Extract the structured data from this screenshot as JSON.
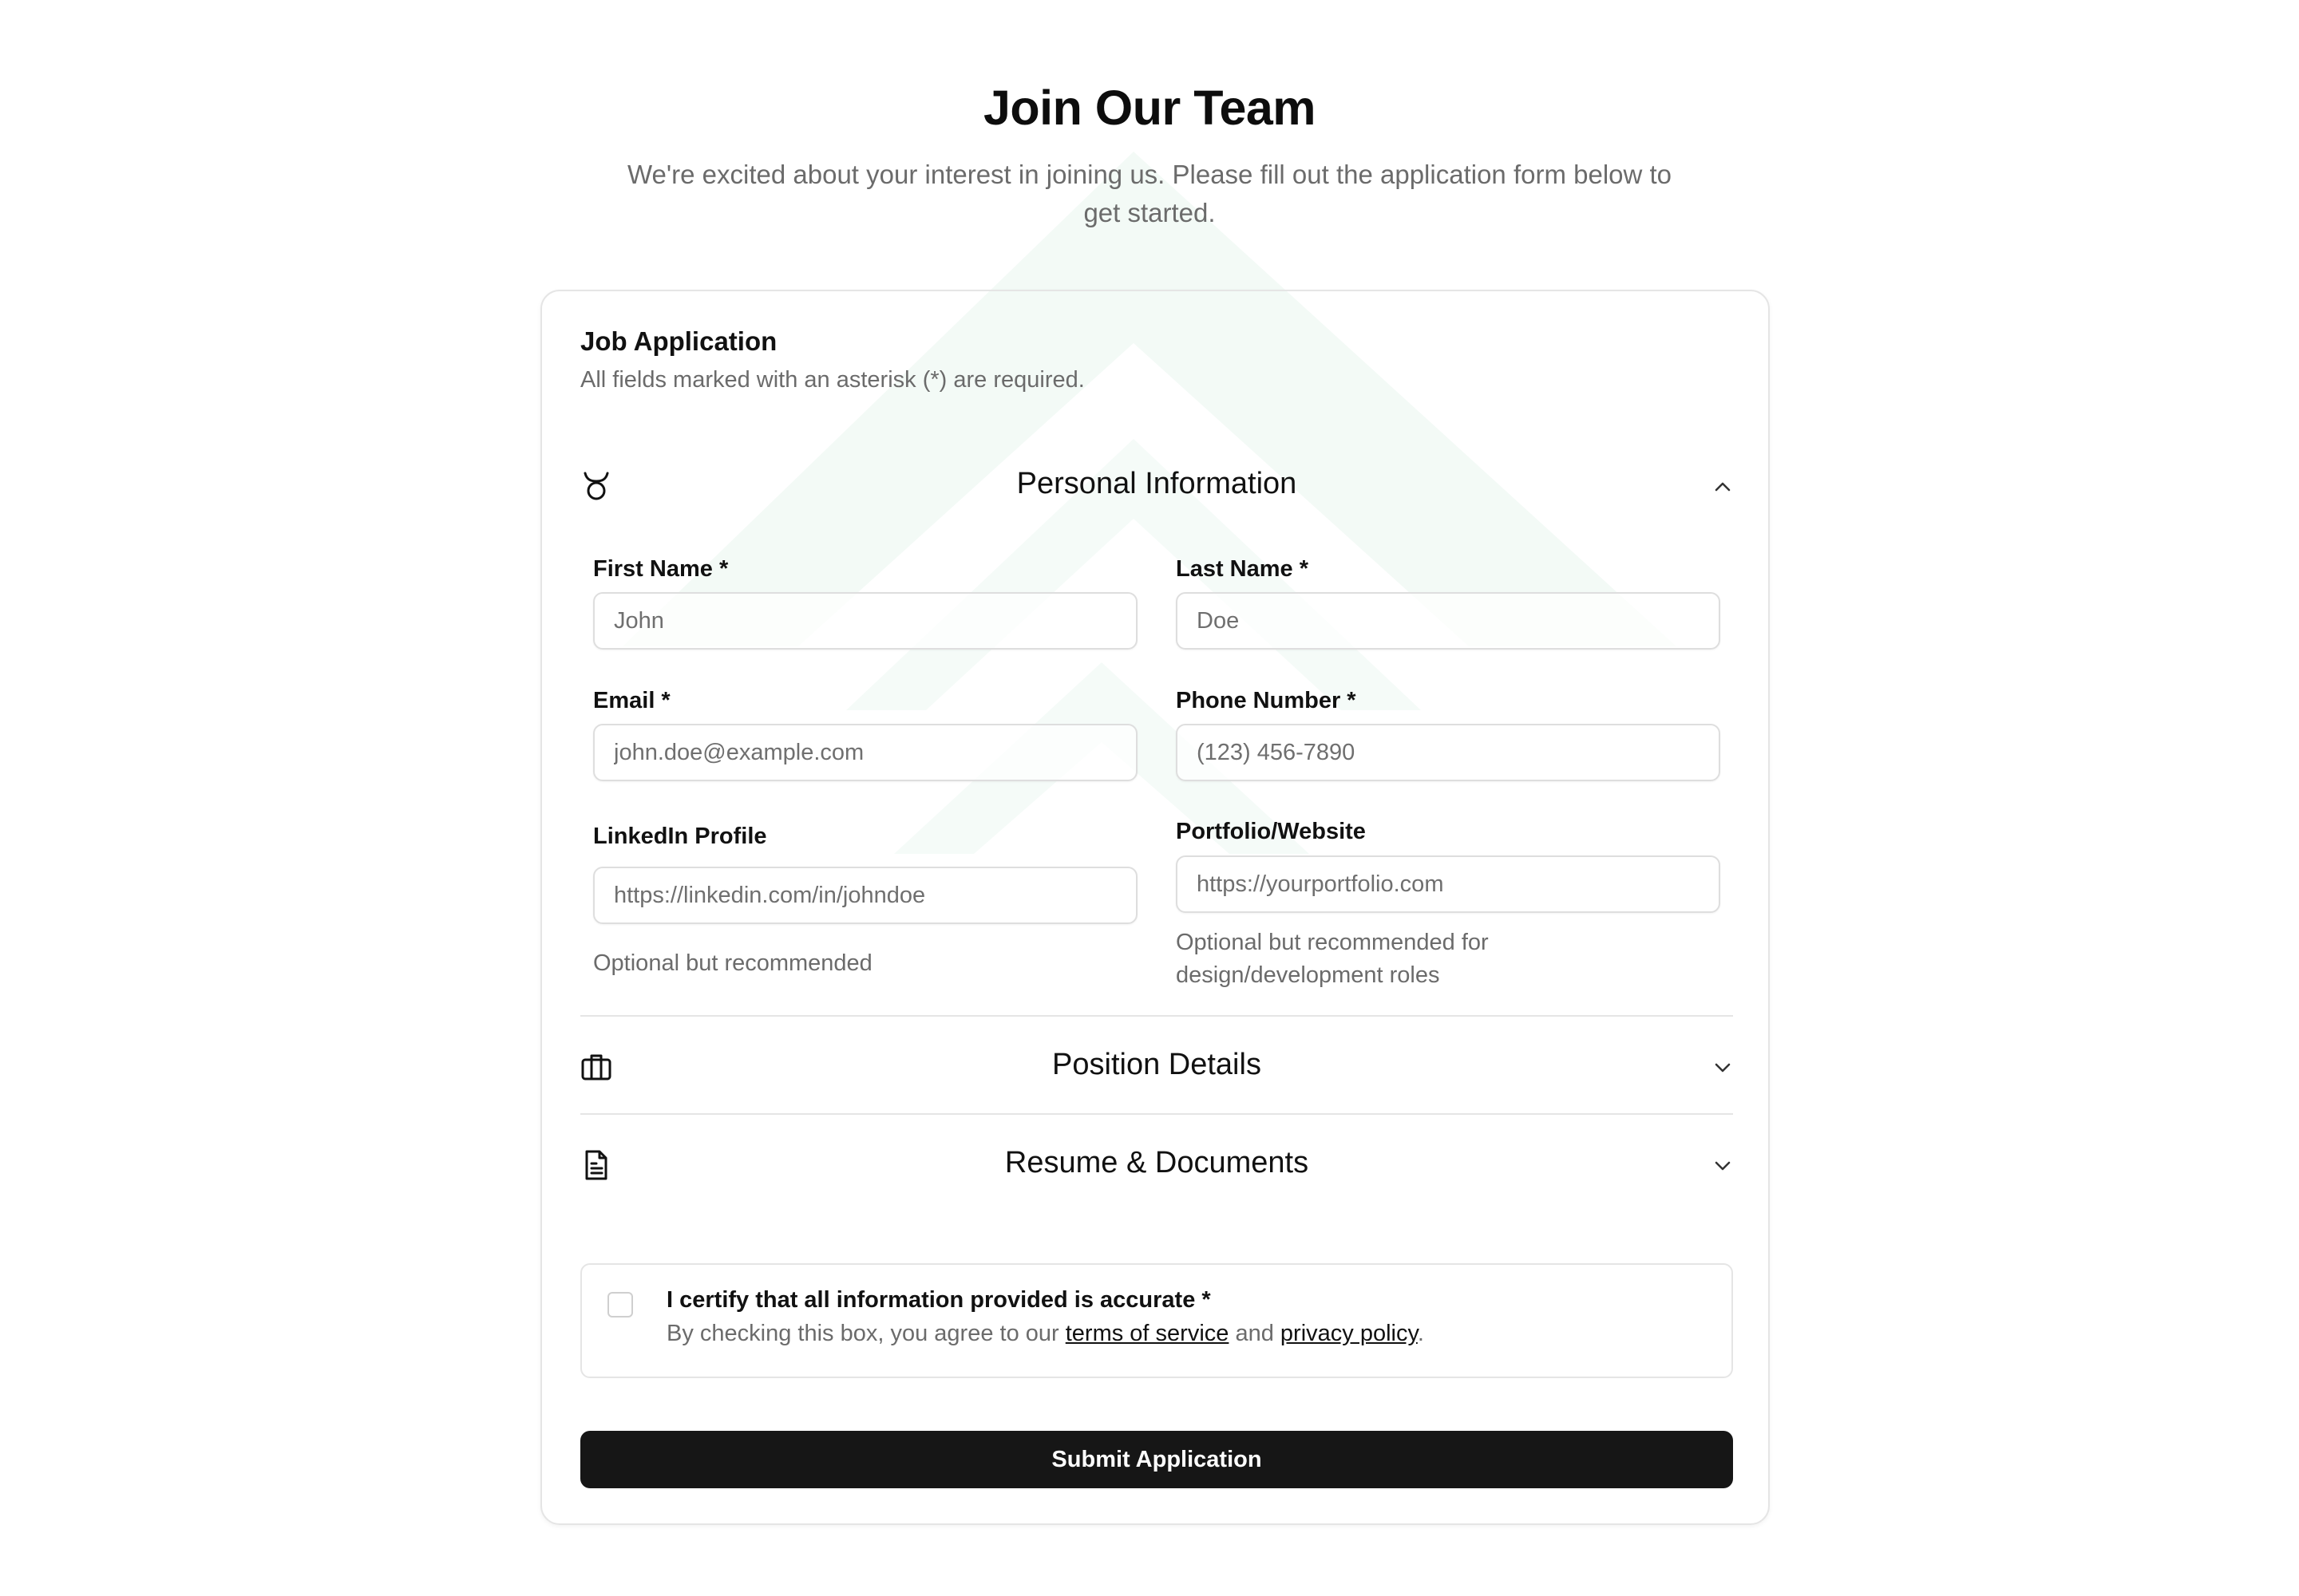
{
  "hero": {
    "title": "Join Our Team",
    "subtitle": "We're excited about your interest in joining us. Please fill out the application form below to get started."
  },
  "form": {
    "title": "Job Application",
    "subtitle": "All fields marked with an asterisk (*) are required."
  },
  "sections": {
    "personal": {
      "title": "Personal Information",
      "icon": "taurus-icon",
      "expanded": true
    },
    "position": {
      "title": "Position Details",
      "icon": "briefcase-icon",
      "expanded": false
    },
    "resume": {
      "title": "Resume & Documents",
      "icon": "document-icon",
      "expanded": false
    }
  },
  "fields": {
    "first_name": {
      "label": "First Name *",
      "placeholder": "John",
      "value": ""
    },
    "last_name": {
      "label": "Last Name *",
      "placeholder": "Doe",
      "value": ""
    },
    "email": {
      "label": "Email *",
      "placeholder": "john.doe@example.com",
      "value": ""
    },
    "phone": {
      "label": "Phone Number *",
      "placeholder": "(123) 456-7890",
      "value": ""
    },
    "linkedin": {
      "label": "LinkedIn Profile",
      "placeholder": "https://linkedin.com/in/johndoe",
      "value": "",
      "hint": "Optional but recommended"
    },
    "portfolio": {
      "label": "Portfolio/Website",
      "placeholder": "https://yourportfolio.com",
      "value": "",
      "hint_line1": "Optional but recommended for",
      "hint_line2": "design/development roles"
    }
  },
  "certify": {
    "title": "I certify that all information provided is accurate *",
    "text_before": "By checking this box, you agree to our ",
    "terms_link": "terms of service",
    "text_between": " and ",
    "privacy_link": "privacy policy",
    "text_after": ".",
    "checked": false
  },
  "submit_label": "Submit Application",
  "colors": {
    "button_bg": "#161616",
    "muted_text": "#6b6b6b",
    "border": "#e5e5e5",
    "watermark": "#f3faf6"
  }
}
